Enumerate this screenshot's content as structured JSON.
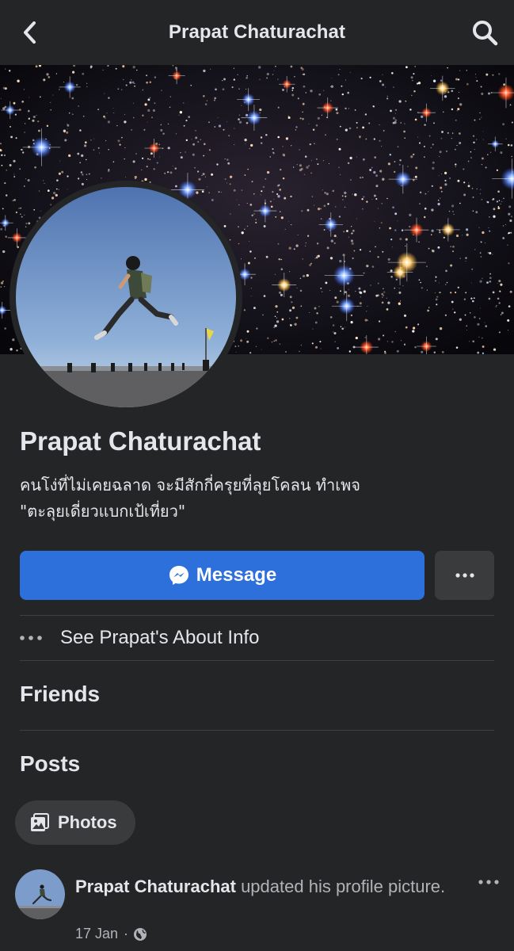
{
  "header": {
    "title": "Prapat Chaturachat",
    "back_icon": "chevron-left-icon",
    "search_icon": "search-icon"
  },
  "profile": {
    "name": "Prapat Chaturachat",
    "bio_line1": "คนโง่ที่ไม่เคยฉลาด จะมีสักกี่ครุยที่ลุยโคลน ทำเพจ",
    "bio_line2": "\"ตะลุยเดี่ยวแบกเป้เที่ยว\""
  },
  "actions": {
    "message_label": "Message",
    "message_icon": "messenger-icon",
    "more_icon": "more-horizontal-icon"
  },
  "about": {
    "label": "See Prapat's About Info"
  },
  "sections": {
    "friends": "Friends",
    "posts": "Posts"
  },
  "filters": {
    "photos_label": "Photos"
  },
  "post": {
    "author": "Prapat Chaturachat",
    "action": " updated his profile picture.",
    "date": "17 Jan",
    "separator": "·",
    "audience_icon": "globe-icon"
  },
  "colors": {
    "background": "#242526",
    "primary_button": "#2d6fdb",
    "secondary_button": "#3a3b3c",
    "text_primary": "#e4e6eb",
    "text_secondary": "#b0b3b8",
    "divider": "#3e4042"
  }
}
